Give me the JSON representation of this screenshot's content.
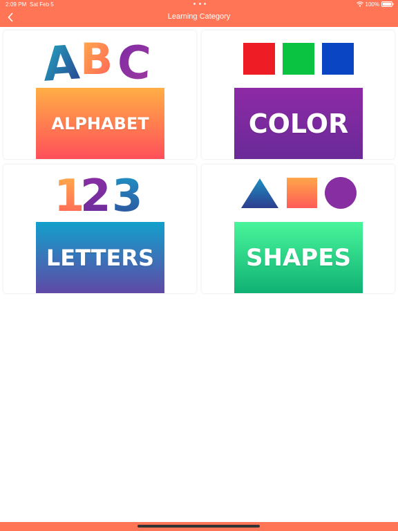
{
  "status_bar": {
    "time": "2:09 PM",
    "date": "Sat Feb 5",
    "battery": "100%"
  },
  "nav": {
    "title": "Learning Category",
    "back_icon": "chevron-left-icon"
  },
  "categories": [
    {
      "label": "ALPHABET",
      "art_text": "ABC",
      "art_colors": [
        "#1f7fc1",
        "#f7963b",
        "#8a2fa3"
      ]
    },
    {
      "label": "COLOR",
      "squares": [
        "#ee1c24",
        "#0ac441",
        "#0a46c4"
      ]
    },
    {
      "label": "LETTERS",
      "art_text": "123",
      "art_colors": [
        "#f7963b",
        "#8a2fa3",
        "#1f7fc1"
      ]
    },
    {
      "label": "SHAPES",
      "shapes": [
        "triangle",
        "square",
        "circle"
      ]
    }
  ],
  "colors": {
    "accent": "#ff7556",
    "banner_orange": [
      "#ffae45",
      "#ff4f5a"
    ],
    "banner_purple": [
      "#8d2aa5",
      "#6a2a98"
    ],
    "banner_blue": [
      "#12a0cb",
      "#6049a6"
    ],
    "banner_green": [
      "#49f59b",
      "#0fb173"
    ]
  }
}
